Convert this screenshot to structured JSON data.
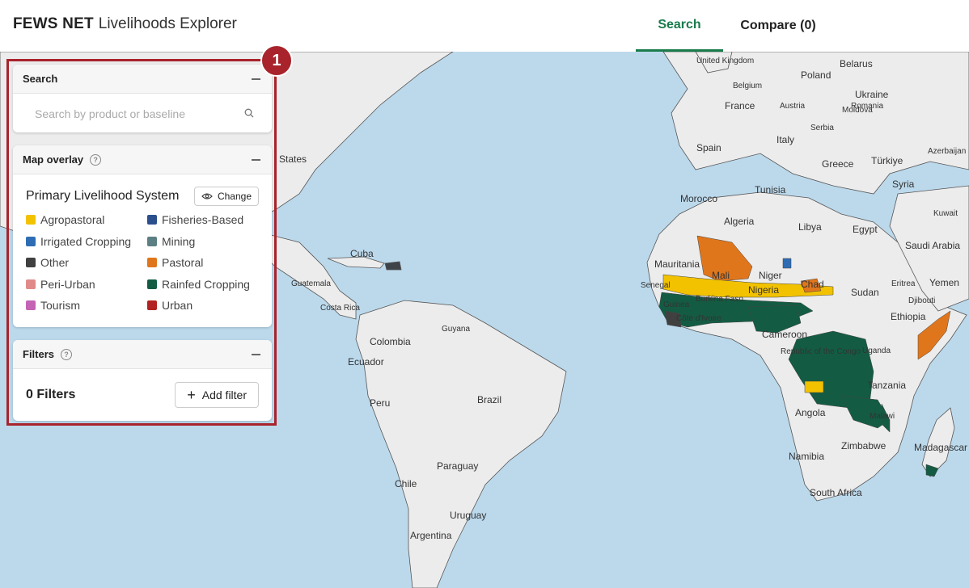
{
  "header": {
    "brand_bold": "FEWS NET",
    "brand_rest": "Livelihoods Explorer",
    "tabs": [
      {
        "label": "Search",
        "active": true
      },
      {
        "label": "Compare (0)",
        "active": false
      }
    ],
    "accent_color": "#1a7b4b"
  },
  "annotation": {
    "badge_number": "1",
    "highlight_color": "#a8232b"
  },
  "search_panel": {
    "title": "Search",
    "placeholder": "Search by product or baseline",
    "icon": "search-icon"
  },
  "overlay_panel": {
    "title": "Map overlay",
    "overlay_name": "Primary Livelihood System",
    "change_label": "Change",
    "legend": [
      {
        "label": "Agropastoral",
        "color": "#f2c200"
      },
      {
        "label": "Fisheries-Based",
        "color": "#2b4f8c"
      },
      {
        "label": "Irrigated Cropping",
        "color": "#2e6db4"
      },
      {
        "label": "Mining",
        "color": "#5c7f83"
      },
      {
        "label": "Other",
        "color": "#404040"
      },
      {
        "label": "Pastoral",
        "color": "#e0761b"
      },
      {
        "label": "Peri-Urban",
        "color": "#e08a8a"
      },
      {
        "label": "Rainfed Cropping",
        "color": "#135c43"
      },
      {
        "label": "Tourism",
        "color": "#c464b4"
      },
      {
        "label": "Urban",
        "color": "#b22222"
      }
    ]
  },
  "filters_panel": {
    "title": "Filters",
    "count_label": "0 Filters",
    "add_label": "Add filter"
  },
  "map": {
    "labels": [
      {
        "text": "United Kingdom",
        "cls": "sm"
      },
      {
        "text": "Belarus"
      },
      {
        "text": "Poland"
      },
      {
        "text": "Belgium",
        "cls": "sm"
      },
      {
        "text": "Ukraine"
      },
      {
        "text": "Moldova",
        "cls": "sm"
      },
      {
        "text": "France"
      },
      {
        "text": "Austria",
        "cls": "sm"
      },
      {
        "text": "Romania",
        "cls": "sm"
      },
      {
        "text": "Serbia",
        "cls": "sm"
      },
      {
        "text": "Italy"
      },
      {
        "text": "Spain"
      },
      {
        "text": "Greece"
      },
      {
        "text": "Türkiye"
      },
      {
        "text": "Azerbaijan",
        "cls": "sm"
      },
      {
        "text": "Syria"
      },
      {
        "text": "Tunisia"
      },
      {
        "text": "Morocco"
      },
      {
        "text": "Algeria"
      },
      {
        "text": "Libya"
      },
      {
        "text": "Egypt"
      },
      {
        "text": "Kuwait",
        "cls": "sm"
      },
      {
        "text": "Saudi Arabia"
      },
      {
        "text": "Mauritania"
      },
      {
        "text": "Mali"
      },
      {
        "text": "Niger"
      },
      {
        "text": "Chad"
      },
      {
        "text": "Sudan"
      },
      {
        "text": "Eritrea",
        "cls": "sm"
      },
      {
        "text": "Yemen"
      },
      {
        "text": "Senegal",
        "cls": "sm"
      },
      {
        "text": "Burkina Faso",
        "cls": "sm"
      },
      {
        "text": "Djibouti",
        "cls": "sm"
      },
      {
        "text": "Guinea",
        "cls": "sm"
      },
      {
        "text": "Nigeria"
      },
      {
        "text": "Ethiopia"
      },
      {
        "text": "Côte d'Ivoire",
        "cls": "sm"
      },
      {
        "text": "Cameroon"
      },
      {
        "text": "Republic of the Congo",
        "cls": "sm"
      },
      {
        "text": "Uganda",
        "cls": "sm"
      },
      {
        "text": "Tanzania"
      },
      {
        "text": "Angola"
      },
      {
        "text": "Malawi",
        "cls": "sm"
      },
      {
        "text": "Zimbabwe"
      },
      {
        "text": "Madagascar"
      },
      {
        "text": "Namibia"
      },
      {
        "text": "South Africa"
      },
      {
        "text": "States"
      },
      {
        "text": "Cuba"
      },
      {
        "text": "Guatemala",
        "cls": "sm"
      },
      {
        "text": "Costa Rica",
        "cls": "sm"
      },
      {
        "text": "Guyana",
        "cls": "sm"
      },
      {
        "text": "Colombia"
      },
      {
        "text": "Ecuador"
      },
      {
        "text": "Peru"
      },
      {
        "text": "Brazil"
      },
      {
        "text": "Paraguay"
      },
      {
        "text": "Chile"
      },
      {
        "text": "Uruguay"
      },
      {
        "text": "Argentina"
      }
    ]
  }
}
